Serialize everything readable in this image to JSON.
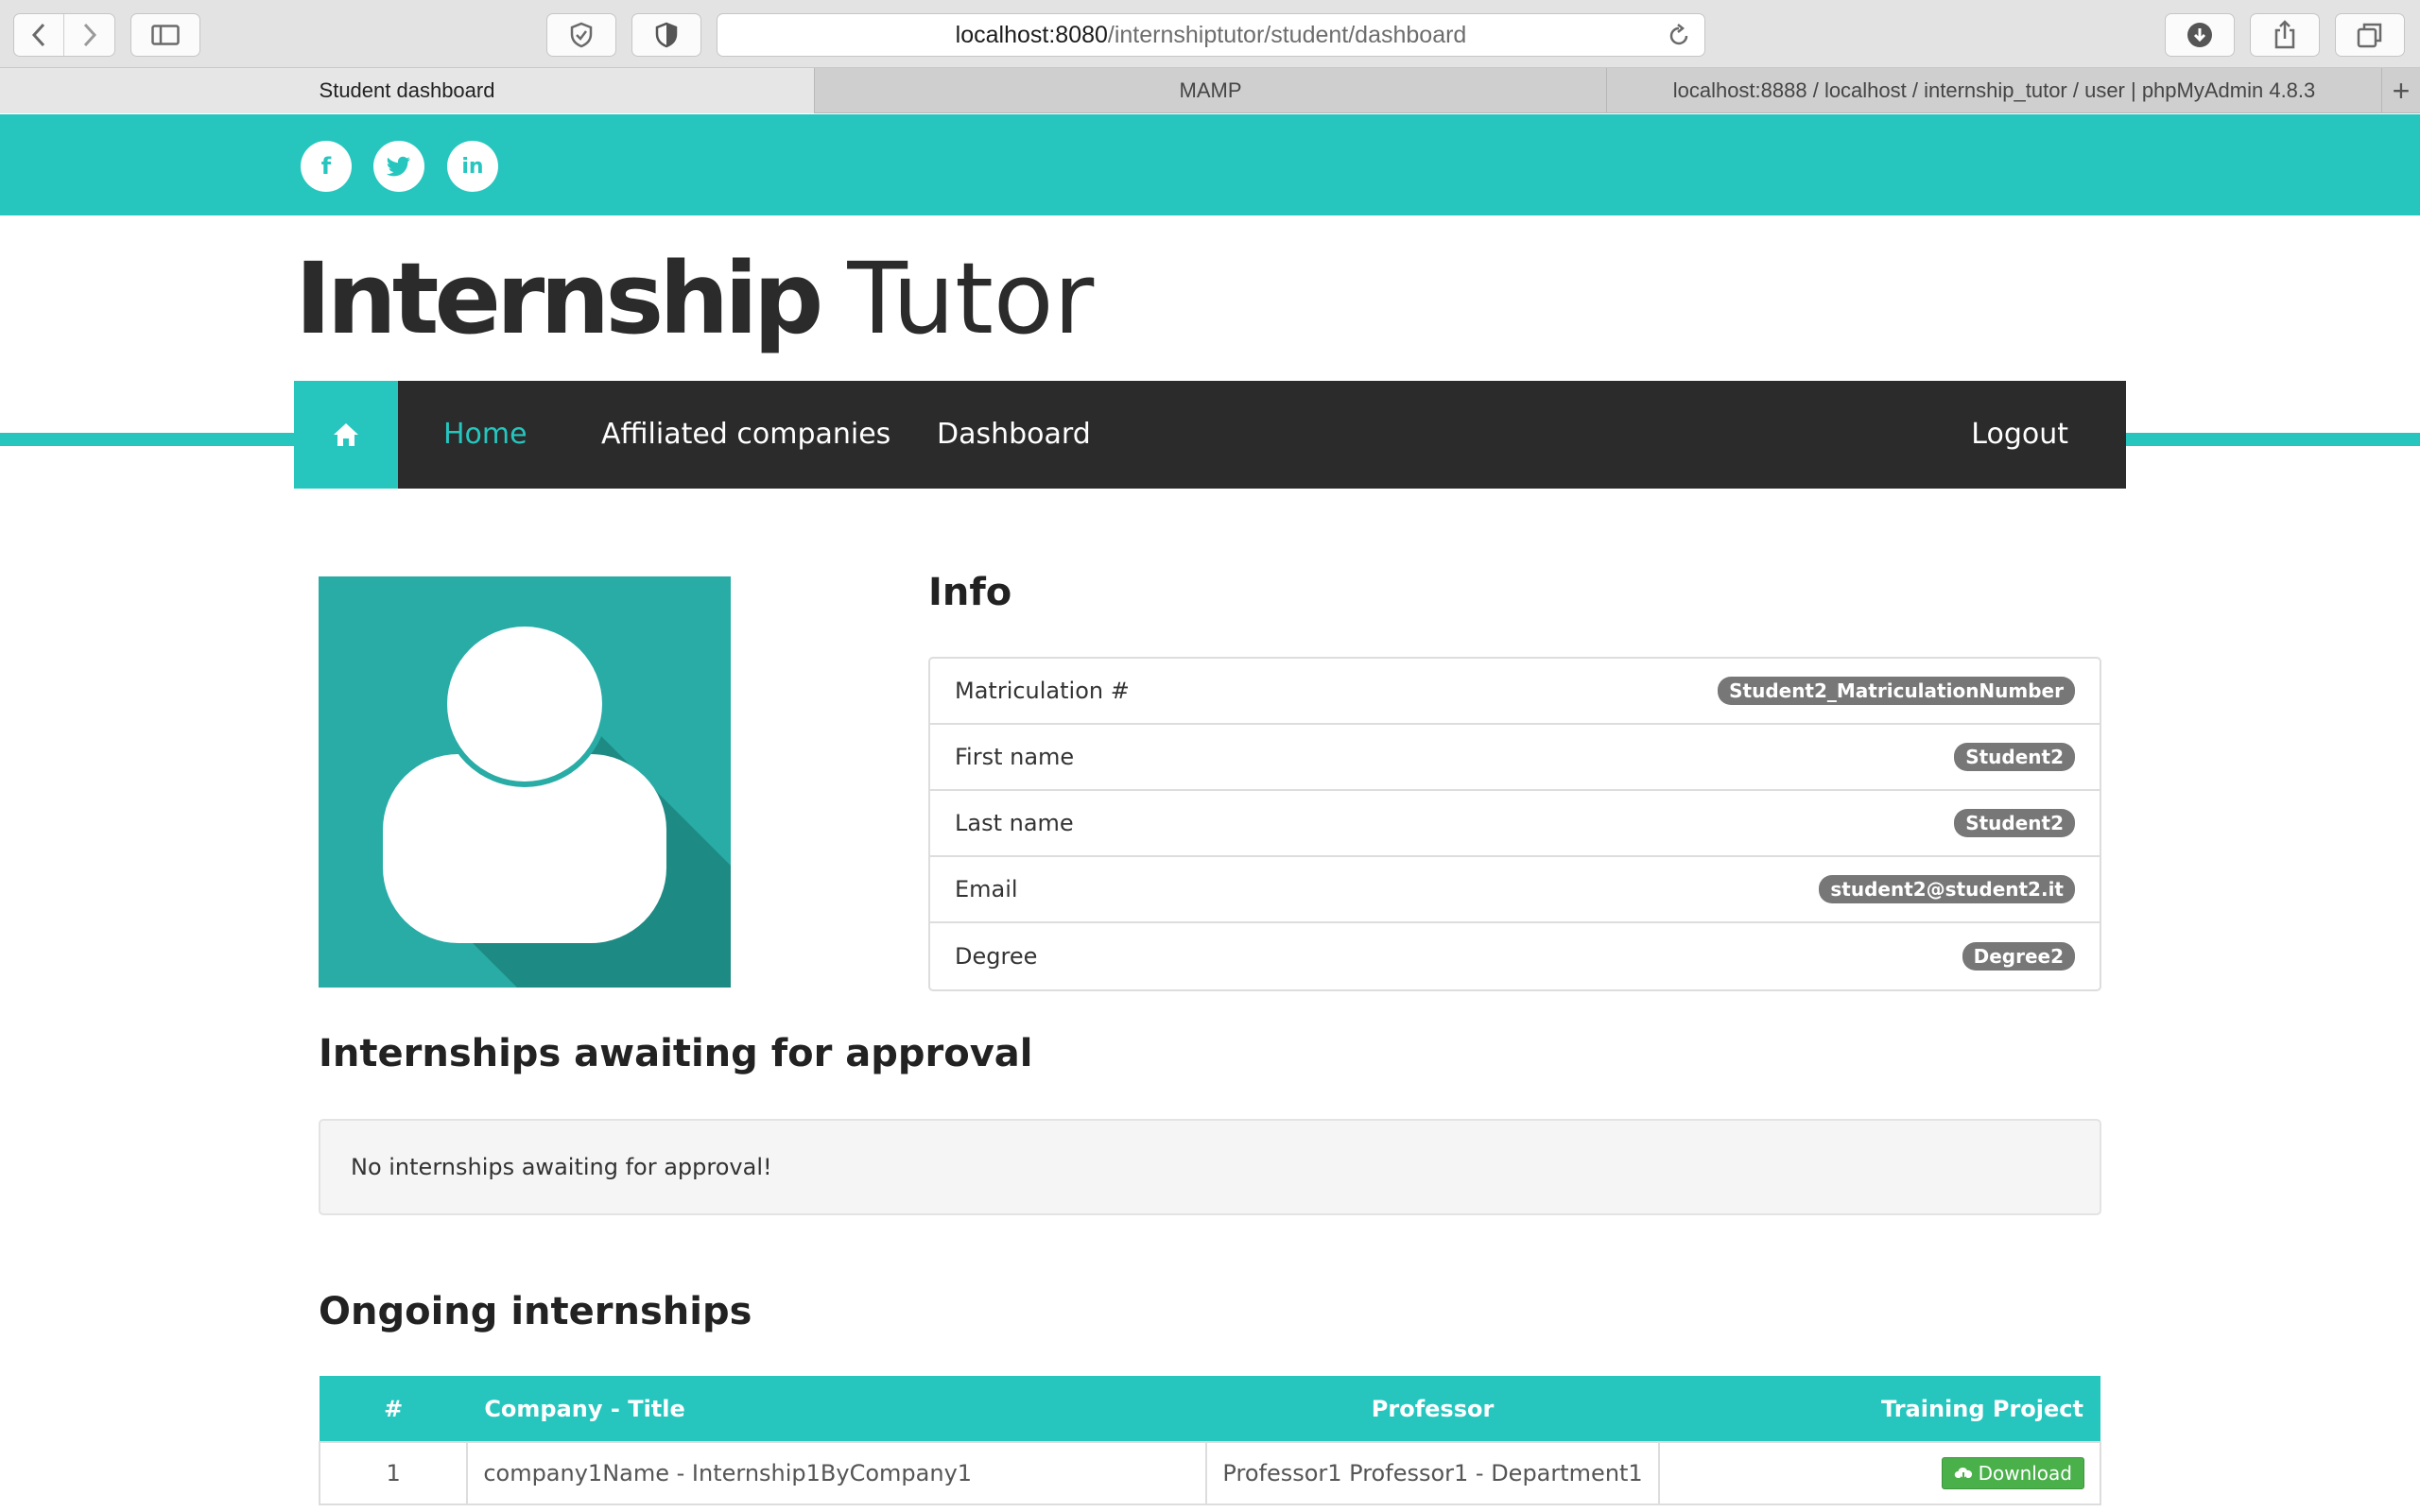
{
  "browser": {
    "url_host": "localhost:8080",
    "url_path": "/internshiptutor/student/dashboard",
    "tabs": [
      {
        "label": "Student dashboard"
      },
      {
        "label": "MAMP"
      },
      {
        "label": "localhost:8888 / localhost / internship_tutor / user | phpMyAdmin 4.8.3"
      }
    ],
    "new_tab_label": "+"
  },
  "social": [
    {
      "icon": "facebook-icon",
      "glyph": "f"
    },
    {
      "icon": "twitter-icon",
      "glyph": "t"
    },
    {
      "icon": "linkedin-icon",
      "glyph": "in"
    }
  ],
  "brand": {
    "bold": "Internship",
    "light": "Tutor"
  },
  "nav": {
    "items": [
      {
        "label": "Home"
      },
      {
        "label": "Affiliated companies"
      },
      {
        "label": "Dashboard"
      }
    ],
    "logout": "Logout"
  },
  "info": {
    "title": "Info",
    "rows": [
      {
        "label": "Matriculation #",
        "value": "Student2_MatriculationNumber"
      },
      {
        "label": "First name",
        "value": "Student2"
      },
      {
        "label": "Last name",
        "value": "Student2"
      },
      {
        "label": "Email",
        "value": "student2@student2.it"
      },
      {
        "label": "Degree",
        "value": "Degree2"
      }
    ]
  },
  "awaiting": {
    "title": "Internships awaiting for approval",
    "empty_message": "No internships awaiting for approval!"
  },
  "ongoing": {
    "title": "Ongoing internships",
    "columns": [
      "#",
      "Company - Title",
      "Professor",
      "Training Project"
    ],
    "rows": [
      {
        "num": "1",
        "company_title": "company1Name - Internship1ByCompany1",
        "professor": "Professor1 Professor1 - Department1",
        "action": "Download"
      }
    ]
  },
  "colors": {
    "accent": "#26c6bf",
    "navbar": "#2b2b2b",
    "badge": "#777777",
    "download": "#4ab04a"
  }
}
